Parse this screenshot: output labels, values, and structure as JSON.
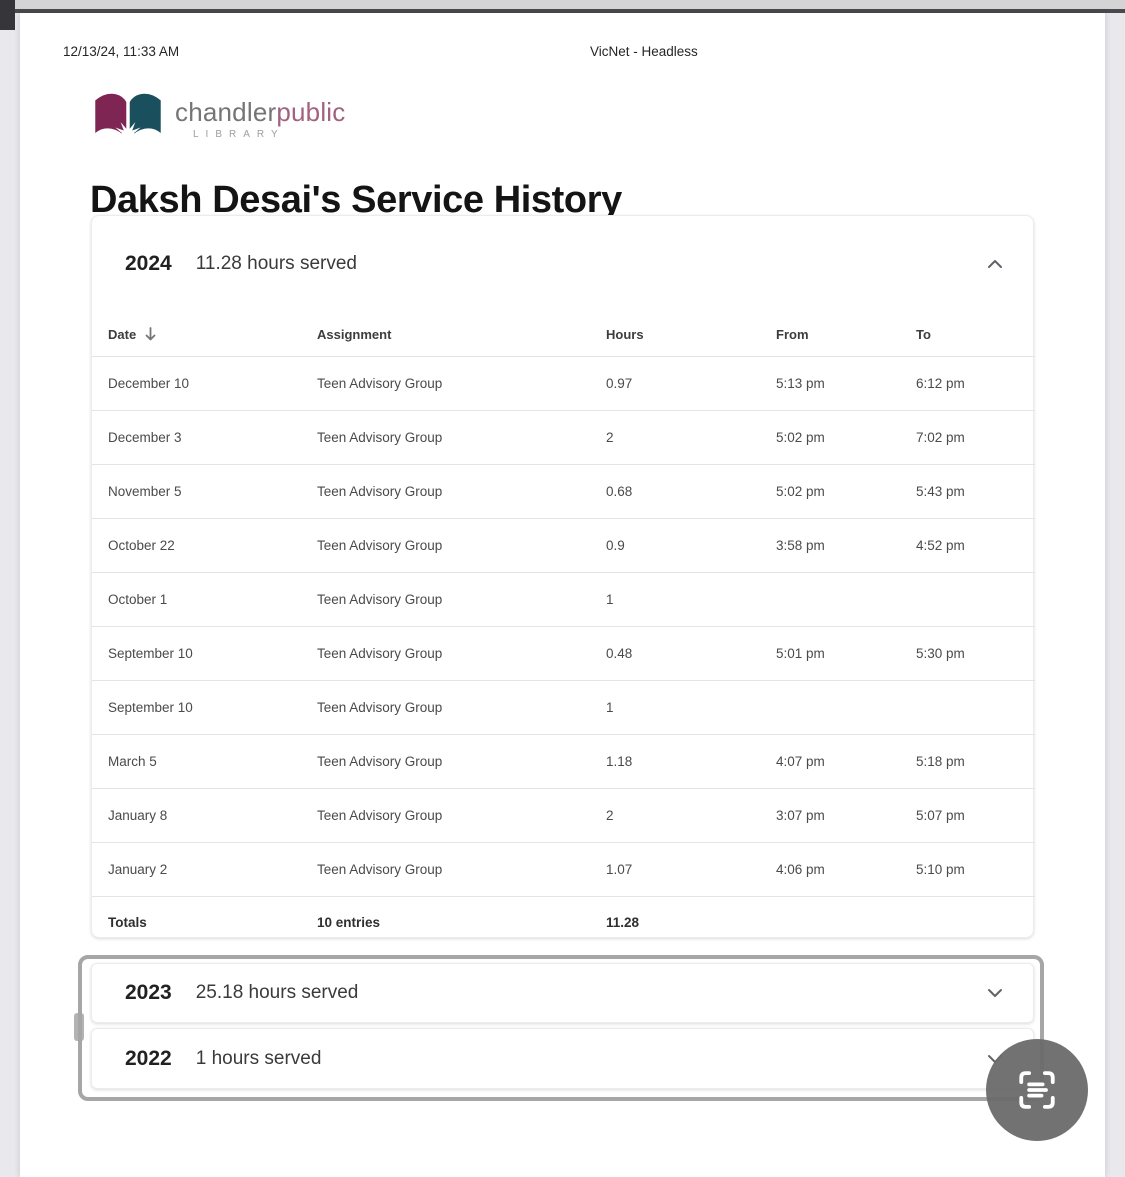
{
  "print_header": {
    "timestamp": "12/13/24, 11:33 AM",
    "doc_title": "VicNet - Headless"
  },
  "logo": {
    "name_part1": "chandler",
    "name_part2": "public",
    "subtitle": "LIBRARY",
    "book_left_color": "#7e2553",
    "book_right_color": "#1a4f5e",
    "name_part2_color": "#a4617f"
  },
  "page_title": "Daksh Desai's Service History",
  "years": [
    {
      "year": "2024",
      "summary": "11.28 hours served",
      "expanded": true
    },
    {
      "year": "2023",
      "summary": "25.18 hours served",
      "expanded": false
    },
    {
      "year": "2022",
      "summary": "1 hours served",
      "expanded": false
    }
  ],
  "table": {
    "columns": [
      "Date",
      "Assignment",
      "Hours",
      "From",
      "To"
    ],
    "sort": {
      "column": "Date",
      "direction": "descending"
    },
    "rows": [
      [
        "December 10",
        "Teen Advisory Group",
        "0.97",
        "5:13 pm",
        "6:12 pm"
      ],
      [
        "December 3",
        "Teen Advisory Group",
        "2",
        "5:02 pm",
        "7:02 pm"
      ],
      [
        "November 5",
        "Teen Advisory Group",
        "0.68",
        "5:02 pm",
        "5:43 pm"
      ],
      [
        "October 22",
        "Teen Advisory Group",
        "0.9",
        "3:58 pm",
        "4:52 pm"
      ],
      [
        "October 1",
        "Teen Advisory Group",
        "1",
        "",
        ""
      ],
      [
        "September 10",
        "Teen Advisory Group",
        "0.48",
        "5:01 pm",
        "5:30 pm"
      ],
      [
        "September 10",
        "Teen Advisory Group",
        "1",
        "",
        ""
      ],
      [
        "March 5",
        "Teen Advisory Group",
        "1.18",
        "4:07 pm",
        "5:18 pm"
      ],
      [
        "January 8",
        "Teen Advisory Group",
        "2",
        "3:07 pm",
        "5:07 pm"
      ],
      [
        "January 2",
        "Teen Advisory Group",
        "1.07",
        "4:06 pm",
        "5:10 pm"
      ]
    ],
    "totals": {
      "label": "Totals",
      "entries": "10 entries",
      "hours": "11.28"
    }
  },
  "icons": {
    "chevron_up": "chevron-up-icon",
    "chevron_down": "chevron-down-icon",
    "sort_descending": "arrow-down-icon",
    "fab": "scan-text-icon"
  },
  "colors": {
    "page_background": "#ffffff",
    "outer_background": "#e9e9ed",
    "highlight_border": "#a6a6a6",
    "fab_background": "#6a6a6a",
    "row_separator": "#e4e4e4"
  }
}
